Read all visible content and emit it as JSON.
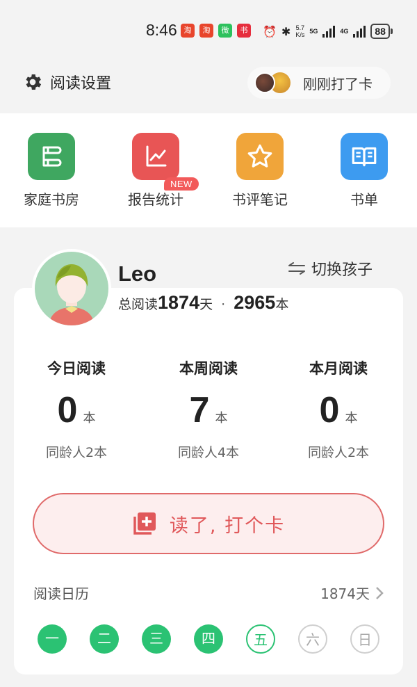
{
  "status_bar": {
    "time": "8:46",
    "net_speed_value": "5.7",
    "net_speed_unit": "K/s",
    "signal1": "5G",
    "signal2": "4G",
    "battery": "88",
    "apps": [
      {
        "name": "淘",
        "color": "#e8452c"
      },
      {
        "name": "淘",
        "color": "#e8452c"
      },
      {
        "name": "微",
        "color": "#2dc15d"
      },
      {
        "name": "书",
        "color": "#e62e3d"
      }
    ]
  },
  "header": {
    "settings_label": "阅读设置",
    "checkin_status": "刚刚打了卡"
  },
  "quick_menu": [
    {
      "label": "家庭书房",
      "icon": "bookshelf-icon",
      "color": "#3fa760"
    },
    {
      "label": "报告统计",
      "icon": "line-chart-icon",
      "color": "#e85555",
      "badge": "NEW"
    },
    {
      "label": "书评笔记",
      "icon": "star-icon",
      "color": "#f0a53a"
    },
    {
      "label": "书单",
      "icon": "open-book-icon",
      "color": "#3d9bf0"
    }
  ],
  "profile": {
    "name": "Leo",
    "switch_label": "切换孩子",
    "total_prefix": "总阅读",
    "total_days": "1874",
    "days_unit": "天",
    "separator": "·",
    "total_books": "2965",
    "books_unit": "本"
  },
  "stats": [
    {
      "title": "今日阅读",
      "value": "0",
      "unit": "本",
      "peer": "同龄人2本"
    },
    {
      "title": "本周阅读",
      "value": "7",
      "unit": "本",
      "peer": "同龄人4本"
    },
    {
      "title": "本月阅读",
      "value": "0",
      "unit": "本",
      "peer": "同龄人2本"
    }
  ],
  "checkin_button": {
    "label": "读了, 打个卡"
  },
  "calendar": {
    "title": "阅读日历",
    "days": "1874天",
    "weekdays": [
      {
        "label": "一",
        "state": "done"
      },
      {
        "label": "二",
        "state": "done"
      },
      {
        "label": "三",
        "state": "done"
      },
      {
        "label": "四",
        "state": "done"
      },
      {
        "label": "五",
        "state": "today"
      },
      {
        "label": "六",
        "state": "future"
      },
      {
        "label": "日",
        "state": "future"
      }
    ]
  },
  "colors": {
    "accent_red": "#e0585a",
    "accent_green": "#2bc273"
  }
}
